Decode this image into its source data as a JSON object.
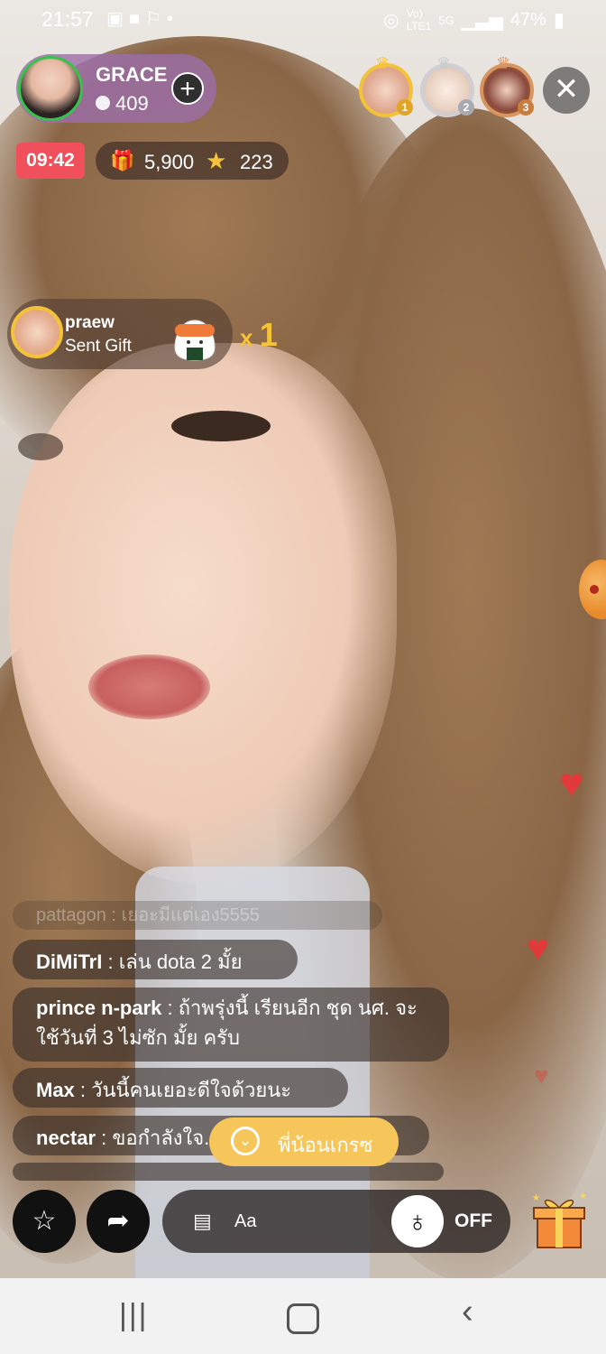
{
  "status_bar": {
    "time": "21:57",
    "left_icons": [
      "gallery-icon",
      "video-icon",
      "accessibility-icon",
      "dot-icon"
    ],
    "right_icons": [
      "hotspot-icon",
      "volte-icon",
      "5g-icon",
      "signal-icon"
    ],
    "battery": "47%"
  },
  "host": {
    "name": "GRACE",
    "viewers": "409"
  },
  "top_viewers": [
    {
      "rank": "1",
      "color": "#f4c23a"
    },
    {
      "rank": "2",
      "color": "#cfcfd4"
    },
    {
      "rank": "3",
      "color": "#d89660"
    }
  ],
  "timer": "09:42",
  "stats": {
    "coins": "5,900",
    "stars": "223"
  },
  "gift_event": {
    "user": "praew",
    "message": "Sent Gift",
    "multiplier_prefix": "x",
    "multiplier": "1"
  },
  "chat": {
    "faded": "pattagon : เยอะมีแต่เอง5555",
    "messages": [
      {
        "user": "DiMiTrI",
        "text": ": เล่น dota 2 มั้ย"
      },
      {
        "user": "prince  n-park",
        "text": ": ถ้าพรุ่งนี้ เรียนอีก ชุด นศ. จะใช้วันที่ 3 ไม่ซัก มั้ย ครับ"
      },
      {
        "user": "Max",
        "text": ": วันนี้คนเยอะดีใจด้วยนะ"
      },
      {
        "user": "nectar",
        "text": ": ขอกำลังใจ... ะ"
      }
    ],
    "new_message_button": "พี่น้อนเกรซ"
  },
  "bottom_bar": {
    "input_placeholder": "Aa",
    "toggle_label": "OFF"
  },
  "colors": {
    "accent_yellow": "#f6c65a",
    "timer_red": "#f0505b",
    "host_panel": "#9b6eaa"
  }
}
